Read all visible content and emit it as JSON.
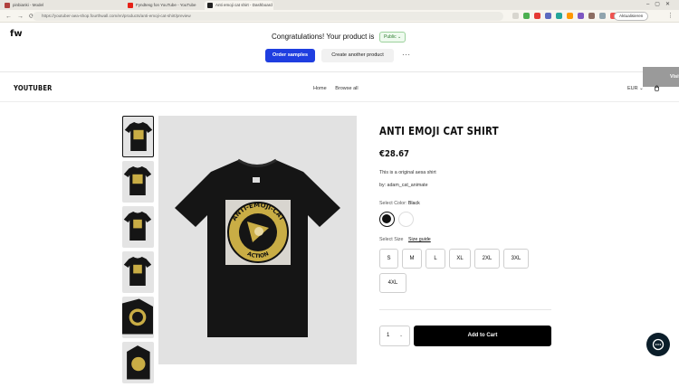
{
  "browser": {
    "tabs": [
      {
        "label": "pinbianki - Model",
        "color": "#b0413e"
      },
      {
        "label": "Fyndtesg fon YouTube - YouTube",
        "color": "#e62117"
      },
      {
        "label": "Anti emoji cat shirt - Dashboard",
        "color": "#222222"
      }
    ],
    "url": "https://youtuber-aea-shop.fourthwall.com/en/products/anti-emoji-cat-shirt/preview",
    "profile_label": "Aktualisieren"
  },
  "fw_bar": {
    "logo": "fw",
    "congrats_text": "Congratulations! Your product is",
    "public_badge": "Public",
    "order_samples_label": "Order samples",
    "create_another_label": "Create another product",
    "more_label": "···",
    "visit_label": "Visit"
  },
  "shop": {
    "logo": "YOUTUBER",
    "nav": [
      "Home",
      "Browse all"
    ],
    "currency": "EUR"
  },
  "product": {
    "title": "ANTI EMOJI CAT SHIRT",
    "price": "€28.67",
    "description": "This is a original aesa shirt",
    "by": "by: adam_cat_animate",
    "color_label": "Select Color:",
    "color_selected": "Black",
    "size_label": "Select Size",
    "size_guide_label": "Size guide",
    "sizes": [
      "S",
      "M",
      "L",
      "XL",
      "2XL",
      "3XL",
      "4XL"
    ],
    "quantity": "1",
    "add_to_cart_label": "Add to Cart",
    "print_text_top": "ANTI-EMOJI-CAT",
    "print_text_bottom": "ACTION"
  },
  "colors": {
    "primary_button": "#1f3ee0",
    "public_badge": "#2f7d32",
    "shirt": "#151515",
    "print_gold": "#c9ad45"
  }
}
